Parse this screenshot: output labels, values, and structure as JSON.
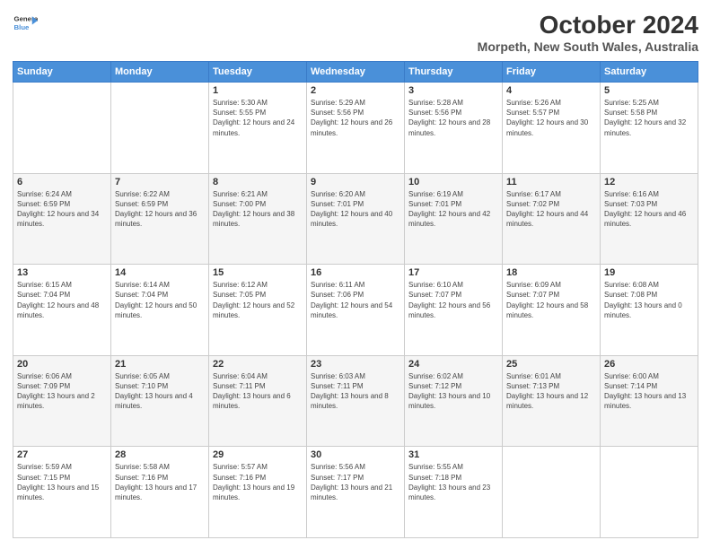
{
  "logo": {
    "line1": "General",
    "line2": "Blue"
  },
  "title": "October 2024",
  "subtitle": "Morpeth, New South Wales, Australia",
  "days_of_week": [
    "Sunday",
    "Monday",
    "Tuesday",
    "Wednesday",
    "Thursday",
    "Friday",
    "Saturday"
  ],
  "weeks": [
    [
      {
        "day": "",
        "sunrise": "",
        "sunset": "",
        "daylight": ""
      },
      {
        "day": "",
        "sunrise": "",
        "sunset": "",
        "daylight": ""
      },
      {
        "day": "1",
        "sunrise": "Sunrise: 5:30 AM",
        "sunset": "Sunset: 5:55 PM",
        "daylight": "Daylight: 12 hours and 24 minutes."
      },
      {
        "day": "2",
        "sunrise": "Sunrise: 5:29 AM",
        "sunset": "Sunset: 5:56 PM",
        "daylight": "Daylight: 12 hours and 26 minutes."
      },
      {
        "day": "3",
        "sunrise": "Sunrise: 5:28 AM",
        "sunset": "Sunset: 5:56 PM",
        "daylight": "Daylight: 12 hours and 28 minutes."
      },
      {
        "day": "4",
        "sunrise": "Sunrise: 5:26 AM",
        "sunset": "Sunset: 5:57 PM",
        "daylight": "Daylight: 12 hours and 30 minutes."
      },
      {
        "day": "5",
        "sunrise": "Sunrise: 5:25 AM",
        "sunset": "Sunset: 5:58 PM",
        "daylight": "Daylight: 12 hours and 32 minutes."
      }
    ],
    [
      {
        "day": "6",
        "sunrise": "Sunrise: 6:24 AM",
        "sunset": "Sunset: 6:59 PM",
        "daylight": "Daylight: 12 hours and 34 minutes."
      },
      {
        "day": "7",
        "sunrise": "Sunrise: 6:22 AM",
        "sunset": "Sunset: 6:59 PM",
        "daylight": "Daylight: 12 hours and 36 minutes."
      },
      {
        "day": "8",
        "sunrise": "Sunrise: 6:21 AM",
        "sunset": "Sunset: 7:00 PM",
        "daylight": "Daylight: 12 hours and 38 minutes."
      },
      {
        "day": "9",
        "sunrise": "Sunrise: 6:20 AM",
        "sunset": "Sunset: 7:01 PM",
        "daylight": "Daylight: 12 hours and 40 minutes."
      },
      {
        "day": "10",
        "sunrise": "Sunrise: 6:19 AM",
        "sunset": "Sunset: 7:01 PM",
        "daylight": "Daylight: 12 hours and 42 minutes."
      },
      {
        "day": "11",
        "sunrise": "Sunrise: 6:17 AM",
        "sunset": "Sunset: 7:02 PM",
        "daylight": "Daylight: 12 hours and 44 minutes."
      },
      {
        "day": "12",
        "sunrise": "Sunrise: 6:16 AM",
        "sunset": "Sunset: 7:03 PM",
        "daylight": "Daylight: 12 hours and 46 minutes."
      }
    ],
    [
      {
        "day": "13",
        "sunrise": "Sunrise: 6:15 AM",
        "sunset": "Sunset: 7:04 PM",
        "daylight": "Daylight: 12 hours and 48 minutes."
      },
      {
        "day": "14",
        "sunrise": "Sunrise: 6:14 AM",
        "sunset": "Sunset: 7:04 PM",
        "daylight": "Daylight: 12 hours and 50 minutes."
      },
      {
        "day": "15",
        "sunrise": "Sunrise: 6:12 AM",
        "sunset": "Sunset: 7:05 PM",
        "daylight": "Daylight: 12 hours and 52 minutes."
      },
      {
        "day": "16",
        "sunrise": "Sunrise: 6:11 AM",
        "sunset": "Sunset: 7:06 PM",
        "daylight": "Daylight: 12 hours and 54 minutes."
      },
      {
        "day": "17",
        "sunrise": "Sunrise: 6:10 AM",
        "sunset": "Sunset: 7:07 PM",
        "daylight": "Daylight: 12 hours and 56 minutes."
      },
      {
        "day": "18",
        "sunrise": "Sunrise: 6:09 AM",
        "sunset": "Sunset: 7:07 PM",
        "daylight": "Daylight: 12 hours and 58 minutes."
      },
      {
        "day": "19",
        "sunrise": "Sunrise: 6:08 AM",
        "sunset": "Sunset: 7:08 PM",
        "daylight": "Daylight: 13 hours and 0 minutes."
      }
    ],
    [
      {
        "day": "20",
        "sunrise": "Sunrise: 6:06 AM",
        "sunset": "Sunset: 7:09 PM",
        "daylight": "Daylight: 13 hours and 2 minutes."
      },
      {
        "day": "21",
        "sunrise": "Sunrise: 6:05 AM",
        "sunset": "Sunset: 7:10 PM",
        "daylight": "Daylight: 13 hours and 4 minutes."
      },
      {
        "day": "22",
        "sunrise": "Sunrise: 6:04 AM",
        "sunset": "Sunset: 7:11 PM",
        "daylight": "Daylight: 13 hours and 6 minutes."
      },
      {
        "day": "23",
        "sunrise": "Sunrise: 6:03 AM",
        "sunset": "Sunset: 7:11 PM",
        "daylight": "Daylight: 13 hours and 8 minutes."
      },
      {
        "day": "24",
        "sunrise": "Sunrise: 6:02 AM",
        "sunset": "Sunset: 7:12 PM",
        "daylight": "Daylight: 13 hours and 10 minutes."
      },
      {
        "day": "25",
        "sunrise": "Sunrise: 6:01 AM",
        "sunset": "Sunset: 7:13 PM",
        "daylight": "Daylight: 13 hours and 12 minutes."
      },
      {
        "day": "26",
        "sunrise": "Sunrise: 6:00 AM",
        "sunset": "Sunset: 7:14 PM",
        "daylight": "Daylight: 13 hours and 13 minutes."
      }
    ],
    [
      {
        "day": "27",
        "sunrise": "Sunrise: 5:59 AM",
        "sunset": "Sunset: 7:15 PM",
        "daylight": "Daylight: 13 hours and 15 minutes."
      },
      {
        "day": "28",
        "sunrise": "Sunrise: 5:58 AM",
        "sunset": "Sunset: 7:16 PM",
        "daylight": "Daylight: 13 hours and 17 minutes."
      },
      {
        "day": "29",
        "sunrise": "Sunrise: 5:57 AM",
        "sunset": "Sunset: 7:16 PM",
        "daylight": "Daylight: 13 hours and 19 minutes."
      },
      {
        "day": "30",
        "sunrise": "Sunrise: 5:56 AM",
        "sunset": "Sunset: 7:17 PM",
        "daylight": "Daylight: 13 hours and 21 minutes."
      },
      {
        "day": "31",
        "sunrise": "Sunrise: 5:55 AM",
        "sunset": "Sunset: 7:18 PM",
        "daylight": "Daylight: 13 hours and 23 minutes."
      },
      {
        "day": "",
        "sunrise": "",
        "sunset": "",
        "daylight": ""
      },
      {
        "day": "",
        "sunrise": "",
        "sunset": "",
        "daylight": ""
      }
    ]
  ]
}
